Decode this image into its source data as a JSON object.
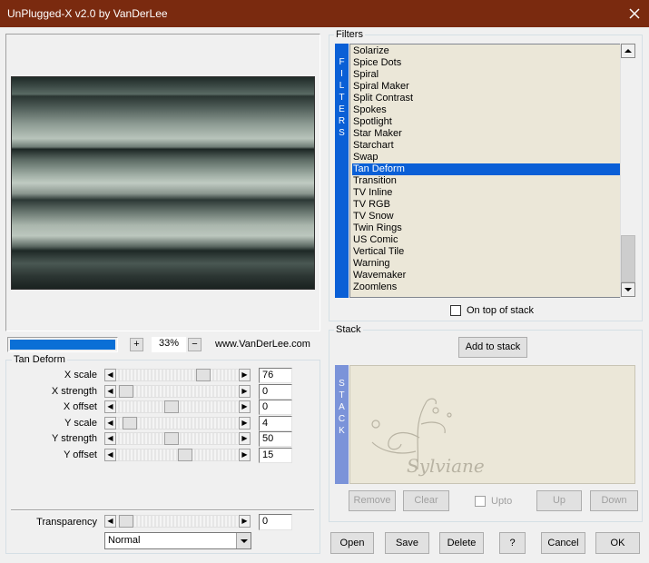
{
  "window": {
    "title": "UnPlugged-X v2.0 by VanDerLee"
  },
  "zoom": {
    "plus_label": "+",
    "value": "33%",
    "minus_label": "−",
    "website": "www.VanDerLee.com"
  },
  "filters": {
    "group_label": "Filters",
    "tab_label": "FILTERS",
    "items": [
      "Solarize",
      "Spice Dots",
      "Spiral",
      "Spiral Maker",
      "Split Contrast",
      "Spokes",
      "Spotlight",
      "Star Maker",
      "Starchart",
      "Swap",
      "Tan Deform",
      "Transition",
      "TV Inline",
      "TV RGB",
      "TV Snow",
      "Twin Rings",
      "US Comic",
      "Vertical Tile",
      "Warning",
      "Wavemaker",
      "Zoomlens"
    ],
    "selected": "Tan Deform",
    "on_top_label": "On top of stack"
  },
  "params": {
    "group_label": "Tan Deform",
    "sliders": [
      {
        "label": "X scale",
        "value": "76",
        "fraction": 0.76
      },
      {
        "label": "X strength",
        "value": "0",
        "fraction": 0.0
      },
      {
        "label": "X offset",
        "value": "0",
        "fraction": 0.45
      },
      {
        "label": "Y scale",
        "value": "4",
        "fraction": 0.04
      },
      {
        "label": "Y strength",
        "value": "50",
        "fraction": 0.45
      },
      {
        "label": "Y offset",
        "value": "15",
        "fraction": 0.58
      }
    ],
    "transparency": {
      "label": "Transparency",
      "value": "0",
      "fraction": 0.0
    },
    "blend_mode": "Normal"
  },
  "stack": {
    "group_label": "Stack",
    "tab_label": "STACK",
    "add_label": "Add to stack",
    "remove_label": "Remove",
    "clear_label": "Clear",
    "upto_label": "Upto",
    "up_label": "Up",
    "down_label": "Down"
  },
  "buttons": {
    "open": "Open",
    "save": "Save",
    "delete": "Delete",
    "help": "?",
    "cancel": "Cancel",
    "ok": "OK"
  },
  "colors": {
    "titlebar": "#7a2a0f",
    "selection": "#0a5fd6",
    "tab": "#0a5fd6",
    "stack_tab": "#7b93d9"
  }
}
